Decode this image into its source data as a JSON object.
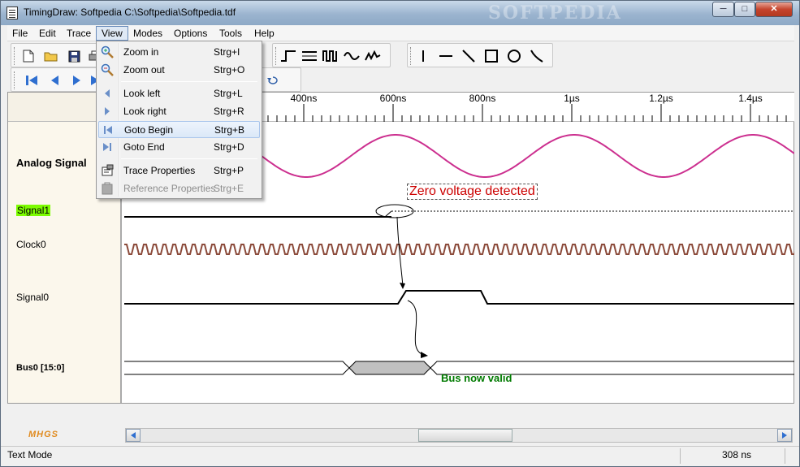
{
  "window": {
    "title": "TimingDraw: Softpedia  C:\\Softpedia\\Softpedia.tdf",
    "watermark": "SOFTPEDIA",
    "minimize": "─",
    "maximize": "□",
    "close": "✕"
  },
  "menubar": {
    "items": [
      "File",
      "Edit",
      "Trace",
      "View",
      "Modes",
      "Options",
      "Tools",
      "Help"
    ],
    "open": "View"
  },
  "view_menu": {
    "items": [
      {
        "label": "Zoom in",
        "shortcut": "Strg+I",
        "icon": "zoom-in-icon"
      },
      {
        "label": "Zoom out",
        "shortcut": "Strg+O",
        "icon": "zoom-out-icon"
      },
      {
        "label": "Look left",
        "shortcut": "Strg+L",
        "icon": "arrow-left-icon"
      },
      {
        "label": "Look right",
        "shortcut": "Strg+R",
        "icon": "arrow-right-icon"
      },
      {
        "label": "Goto Begin",
        "shortcut": "Strg+B",
        "icon": "goto-begin-icon"
      },
      {
        "label": "Goto End",
        "shortcut": "Strg+D",
        "icon": "goto-end-icon"
      },
      {
        "label": "Trace Properties",
        "shortcut": "Strg+P",
        "icon": "trace-properties-icon"
      },
      {
        "label": "Reference Properties",
        "shortcut": "Strg+E",
        "icon": "reference-properties-icon"
      }
    ],
    "highlighted": "Goto Begin",
    "disabled": "Reference Properties"
  },
  "time_axis": {
    "ticks": [
      "400ns",
      "600ns",
      "800ns",
      "1µs",
      "1.2µs",
      "1.4µs"
    ]
  },
  "traces": [
    {
      "label": "Analog Signal",
      "style": "bold"
    },
    {
      "label": "Signal1",
      "style": "highlight",
      "highlight_color": "#7cfc00"
    },
    {
      "label": "Clock0",
      "style": "normal"
    },
    {
      "label": "Signal0",
      "style": "normal"
    },
    {
      "label": "Bus0 [15:0]",
      "style": "bold-small"
    }
  ],
  "annotations": {
    "zero_voltage": "Zero voltage detected",
    "bus_valid": "Bus now valid",
    "zero_voltage_color": "#cc0000",
    "bus_valid_color": "#007a00"
  },
  "colors": {
    "analog_wave": "#cc2f8f",
    "clock_wave": "#8b4a3a",
    "bus_invalid_fill": "#c0c0c0"
  },
  "logo": "MHGS",
  "statusbar": {
    "mode": "Text Mode",
    "time": "308 ns"
  }
}
